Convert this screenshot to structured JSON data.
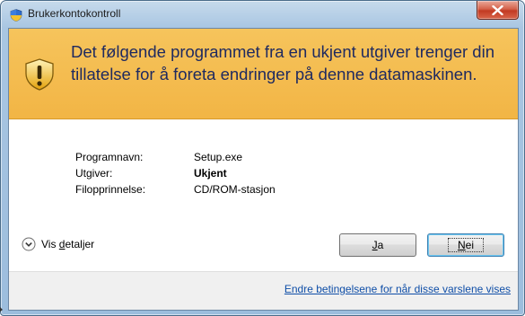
{
  "window": {
    "title": "Brukerkontokontroll",
    "icon": "uac-shield-icon"
  },
  "banner": {
    "headline": "Det følgende programmet fra en ukjent utgiver trenger din tillatelse for å foreta endringer på denne datamaskinen.",
    "icon": "warning-shield-icon",
    "background_color": "#f4bd4f",
    "text_color": "#1f2a60"
  },
  "info": [
    {
      "label": "Programnavn:",
      "value": "Setup.exe",
      "bold": false
    },
    {
      "label": "Utgiver:",
      "value": "Ukjent",
      "bold": true
    },
    {
      "label": "Filopprinnelse:",
      "value": "CD/ROM-stasjon",
      "bold": false
    }
  ],
  "details_toggle": {
    "prefix": "Vis ",
    "underlined": "d",
    "suffix": "etaljer",
    "icon": "chevron-down-circle-icon"
  },
  "buttons": {
    "yes": {
      "underlined": "J",
      "rest": "a"
    },
    "no": {
      "underlined": "N",
      "rest": "ei"
    }
  },
  "footer": {
    "link": "Endre betingelsene for når disse varslene vises",
    "link_color": "#0f4ea7"
  }
}
